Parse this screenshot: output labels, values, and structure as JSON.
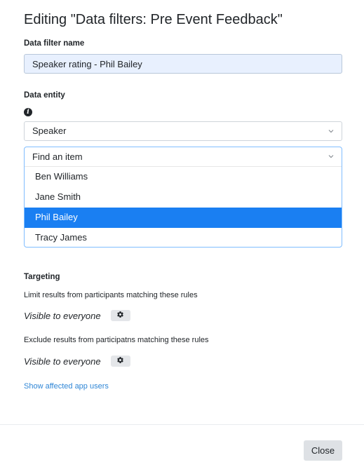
{
  "dialog": {
    "title": "Editing \"Data filters: Pre Event Feedback\""
  },
  "form": {
    "name_label": "Data filter name",
    "name_value": "Speaker rating - Phil Bailey",
    "entity_label": "Data entity",
    "info_icon": "i",
    "entity_value": "Speaker"
  },
  "item_dropdown": {
    "placeholder": "Find an item",
    "options": [
      {
        "label": "Ben Williams",
        "selected": false
      },
      {
        "label": "Jane Smith",
        "selected": false
      },
      {
        "label": "Phil Bailey",
        "selected": true
      },
      {
        "label": "Tracy James",
        "selected": false
      }
    ],
    "selected_color": "#1a7ff2"
  },
  "targeting": {
    "heading": "Targeting",
    "limit_text": "Limit results from participants matching these rules",
    "limit_visibility": "Visible to everyone",
    "exclude_text": "Exclude results from participatns matching these rules",
    "exclude_visibility": "Visible to everyone",
    "affected_link": "Show affected app users",
    "link_color": "#2f86d6"
  },
  "footer": {
    "close_label": "Close"
  }
}
